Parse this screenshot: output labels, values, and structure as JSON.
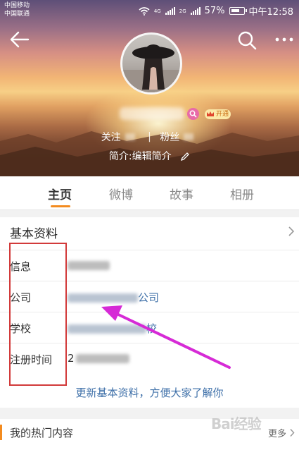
{
  "status_bar": {
    "carrier_1": "中国移动",
    "carrier_2": "中国联通",
    "network_1": "4G",
    "network_2": "2G",
    "battery_percent": "57%",
    "time": "中午12:58"
  },
  "header": {
    "back_icon": "back-arrow-icon",
    "search_icon": "search-icon",
    "more_icon": "more-dots-icon"
  },
  "profile": {
    "vip_badge_label": "开通",
    "follow_label": "关注",
    "follow_divider": "|",
    "fans_label": "粉丝",
    "intro_text": "简介:编辑简介"
  },
  "tabs": [
    {
      "label": "主页",
      "active": true
    },
    {
      "label": "微博",
      "active": false
    },
    {
      "label": "故事",
      "active": false
    },
    {
      "label": "相册",
      "active": false
    }
  ],
  "basic_info": {
    "title": "基本资料",
    "rows": [
      {
        "label": "信息",
        "value_visible": ""
      },
      {
        "label": "公司",
        "value_visible": "公司"
      },
      {
        "label": "学校",
        "value_visible": "校"
      },
      {
        "label": "注册时间",
        "value_visible": "2"
      }
    ],
    "update_link": "更新基本资料，方便大家了解你"
  },
  "hot": {
    "title": "我的热门内容",
    "more_label": "更多"
  },
  "watermark": "Bai经验",
  "colors": {
    "accent": "#f38b1f",
    "link": "#3d6fa8",
    "annotation_box": "#d23a3a",
    "annotation_arrow": "#d62ad6"
  }
}
